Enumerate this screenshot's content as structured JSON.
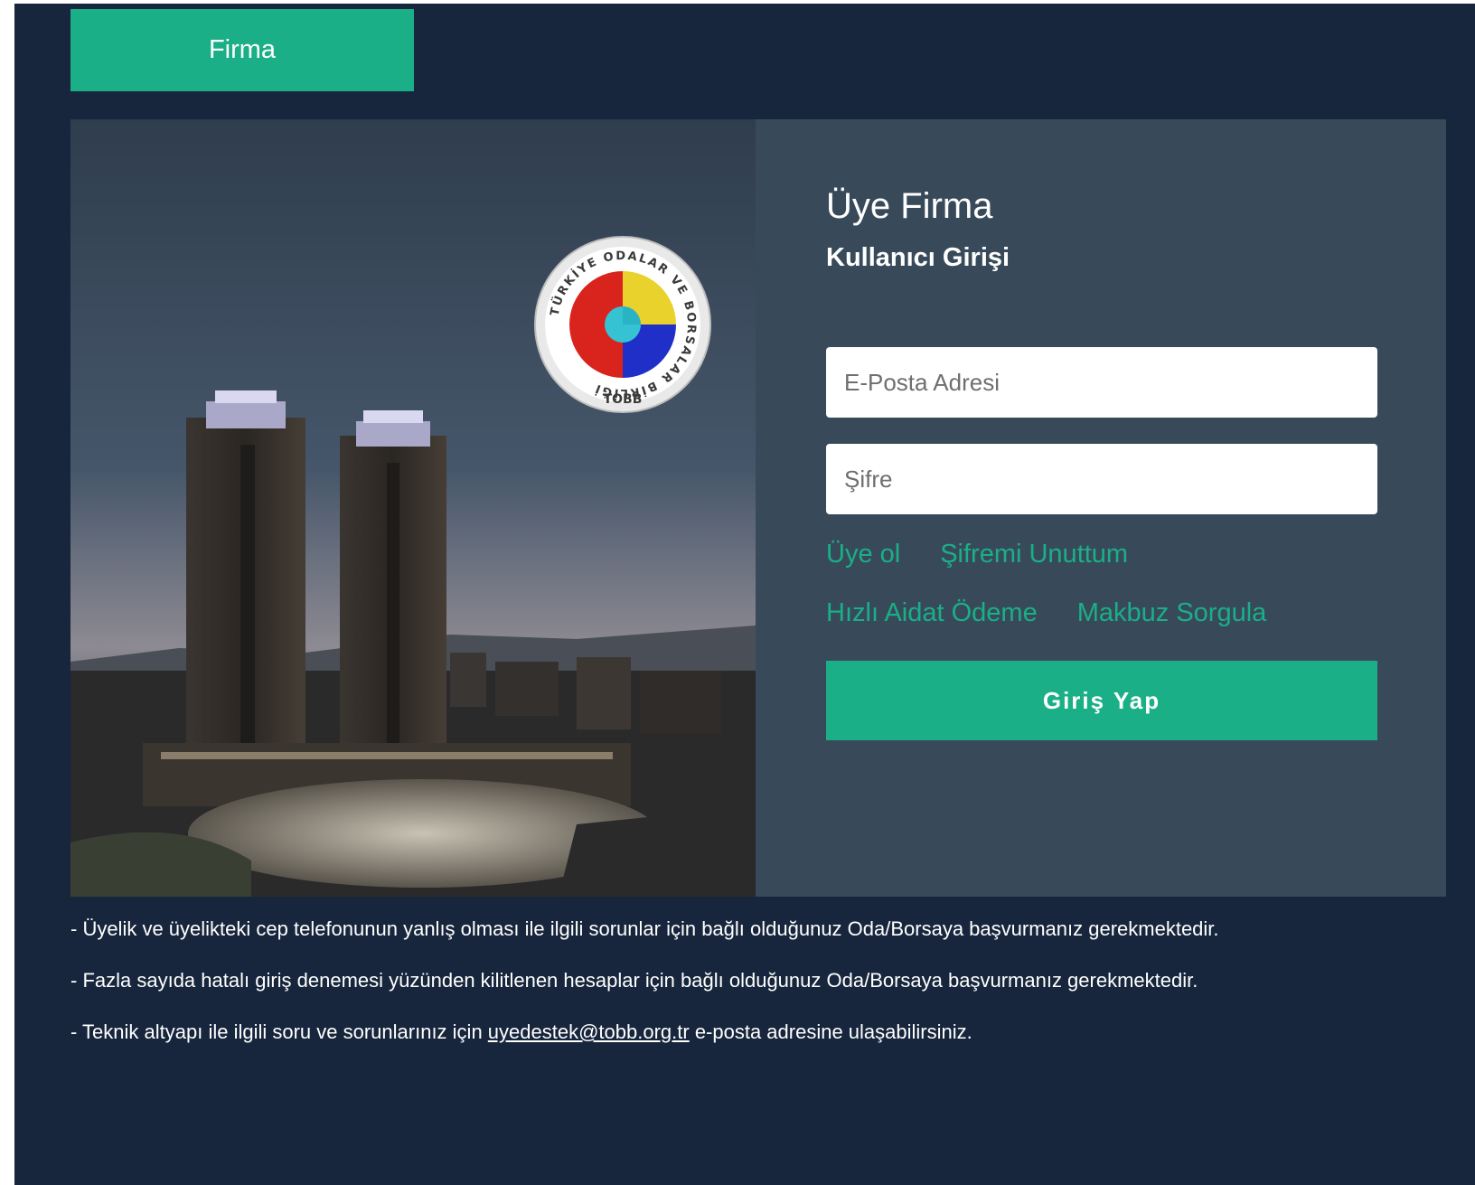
{
  "tab": {
    "label": "Firma"
  },
  "logo": {
    "arc_text": "TÜRKİYE ODALAR VE BORSALAR BİRLİĞİ",
    "short_text": "TOBB"
  },
  "login": {
    "title": "Üye Firma",
    "subtitle": "Kullanıcı Girişi",
    "email_placeholder": "E-Posta Adresi",
    "password_placeholder": "Şifre",
    "register_link": "Üye ol",
    "forgot_link": "Şifremi Unuttum",
    "fast_payment_link": "Hızlı Aidat Ödeme",
    "receipt_link": "Makbuz Sorgula",
    "submit_label": "Giriş Yap"
  },
  "notes": {
    "line1": "- Üyelik ve üyelikteki cep telefonunun yanlış olması ile ilgili sorunlar için bağlı olduğunuz Oda/Borsaya başvurmanız gerekmektedir.",
    "line2": "- Fazla sayıda hatalı giriş denemesi yüzünden kilitlenen hesaplar için bağlı olduğunuz Oda/Borsaya başvurmanız gerekmektedir.",
    "line3_prefix": "- Teknik altyapı ile ilgili soru ve sorunlarınız için ",
    "line3_email": "uyedestek@tobb.org.tr",
    "line3_suffix": " e-posta adresine ulaşabilirsiniz."
  },
  "colors": {
    "page_bg": "#17263c",
    "card_bg": "#384a5a",
    "accent": "#1aaf87"
  },
  "icons": [
    "tobb-logo-icon"
  ]
}
